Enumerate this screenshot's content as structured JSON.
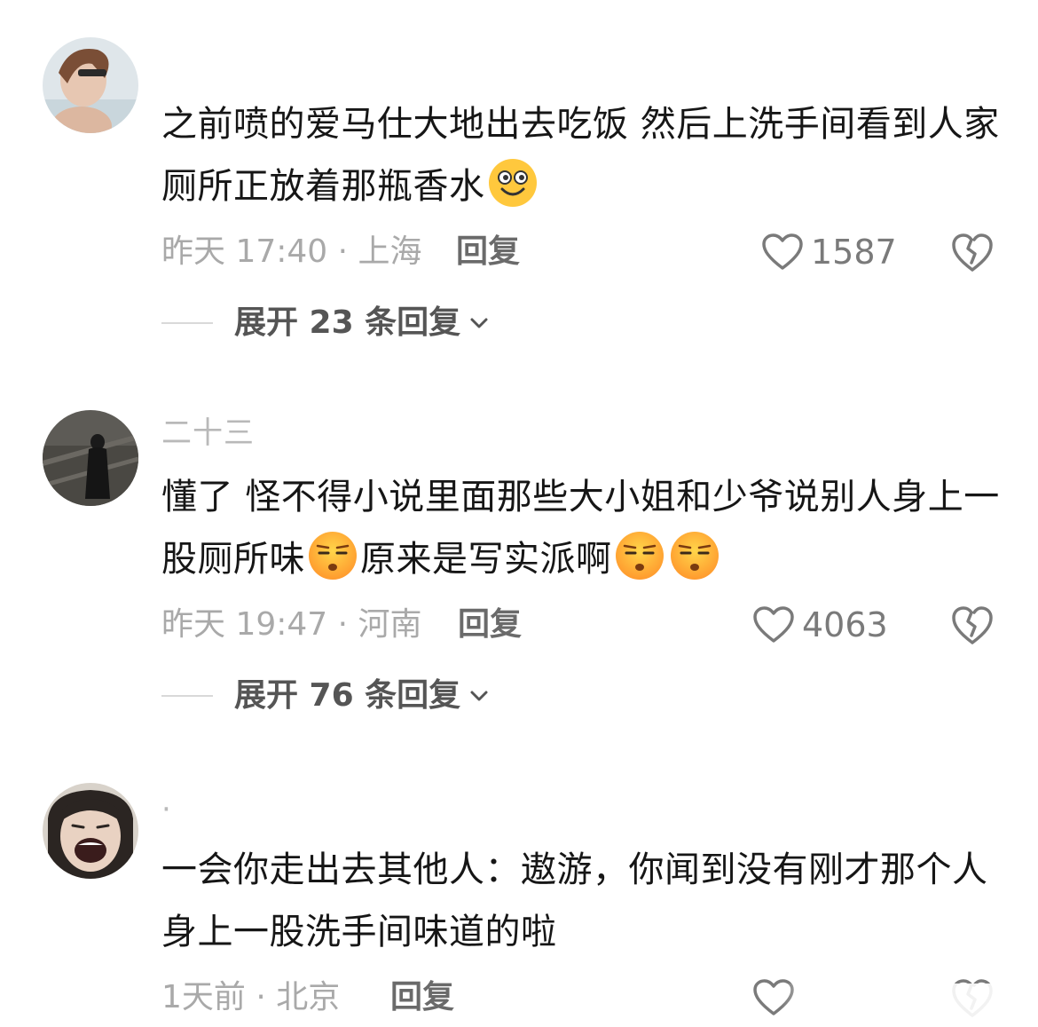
{
  "comments": [
    {
      "username": "",
      "text_part1": "之前喷的爱马仕大地出去吃饭 然后上洗手间看到人家厕所正放着那瓶香水",
      "emoji1": "grin-emoji",
      "meta": "昨天 17:40 · 上海",
      "reply": "回复",
      "likes": "1587",
      "expand": "展开 23 条回复"
    },
    {
      "username": "二十三",
      "text_part1": "懂了 怪不得小说里面那些大小姐和少爷说别人身上一股厕所味",
      "text_part2": "原来是写实派啊",
      "emoji1": "unamused-emoji",
      "meta": "昨天 19:47 · 河南",
      "reply": "回复",
      "likes": "4063",
      "expand": "展开 76 条回复"
    },
    {
      "username": "·",
      "text_part1": "一会你走出去其他人：遨游，你闻到没有刚才那个人身上一股洗手间味道的啦",
      "meta": "1天前 · 北京",
      "reply": "回复",
      "likes": ""
    }
  ],
  "colors": {
    "text": "#161616",
    "meta": "#a9a9a9",
    "username": "#b9b9b9",
    "emoji_yellow": "#ffc83d"
  }
}
